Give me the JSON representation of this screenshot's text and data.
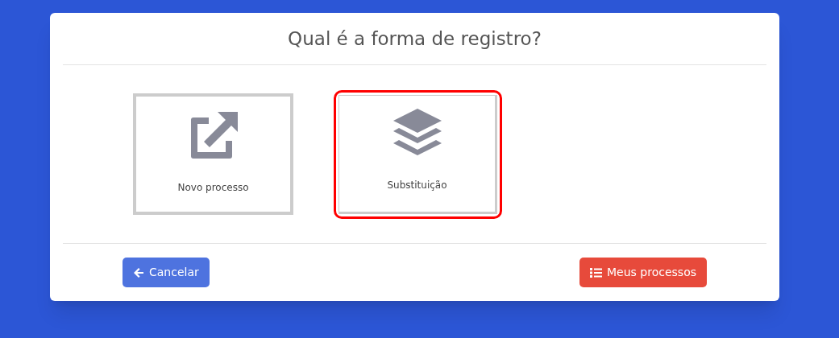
{
  "dialog": {
    "title": "Qual é a forma de registro?",
    "options": [
      {
        "kind": "external",
        "label": "Novo processo",
        "selected": false
      },
      {
        "kind": "layers",
        "label": "Substituição",
        "selected": true
      }
    ],
    "buttons": [
      {
        "kind": "back",
        "label": "Cancelar"
      },
      {
        "kind": "list",
        "label": "Meus processos"
      }
    ]
  }
}
